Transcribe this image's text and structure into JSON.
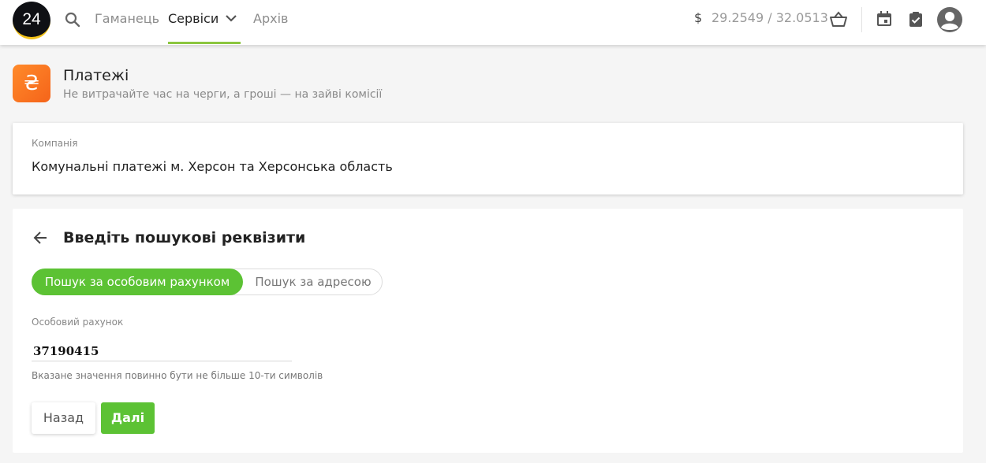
{
  "header": {
    "logo_text": "24",
    "nav": [
      "Гаманець",
      "Сервіси",
      "Архів"
    ],
    "currency_symbol": "$",
    "rate": "29.2549 / 32.0513",
    "icons": [
      "search-icon",
      "chevron-down-icon",
      "basket-icon",
      "calendar-icon",
      "clipboard-check-icon",
      "avatar-icon"
    ]
  },
  "page": {
    "icon_glyph": "₴",
    "title": "Платежі",
    "subtitle": "Не витрачайте час на черги, а гроші — на зайві комісії"
  },
  "company": {
    "label": "Компанія",
    "value": "Комунальні платежі м. Херсон та Херсонська область"
  },
  "search": {
    "title": "Введіть пошукові реквізити",
    "toggle": [
      "Пошук за особовим рахунком",
      "Пошук за адресою"
    ],
    "field_label": "Особовий рахунок",
    "field_value": "37190415",
    "field_hint": "Вказане значення повинно бути не більше 10-ти символів",
    "back_label": "Назад",
    "next_label": "Далі"
  },
  "colors": {
    "accent_green": "#5cc234",
    "nav_underline": "#8cc63f",
    "service_orange": "#f5641a"
  }
}
